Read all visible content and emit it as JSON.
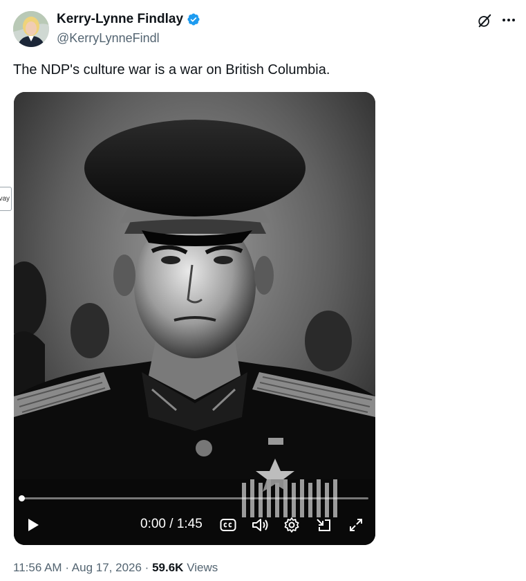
{
  "author": {
    "name": "Kerry-Lynne Findlay",
    "handle": "@KerryLynneFindl",
    "verified": true
  },
  "tweet": {
    "text": "The NDP's culture war is a war on British Columbia."
  },
  "side_tab": {
    "label": "vay"
  },
  "video": {
    "current_time": "0:00",
    "duration": "1:45",
    "time_display": "0:00 / 1:45",
    "progress": 0,
    "controls": [
      "play-icon",
      "captions-icon",
      "volume-icon",
      "settings-icon",
      "pip-icon",
      "fullscreen-icon"
    ]
  },
  "meta": {
    "time": "11:56 AM",
    "date": "Aug 17, 2026",
    "views_count": "59.6K",
    "views_label": "Views",
    "separator": "·"
  },
  "colors": {
    "text_primary": "#0f1419",
    "text_secondary": "#536471",
    "verified_blue": "#1d9bf0"
  }
}
